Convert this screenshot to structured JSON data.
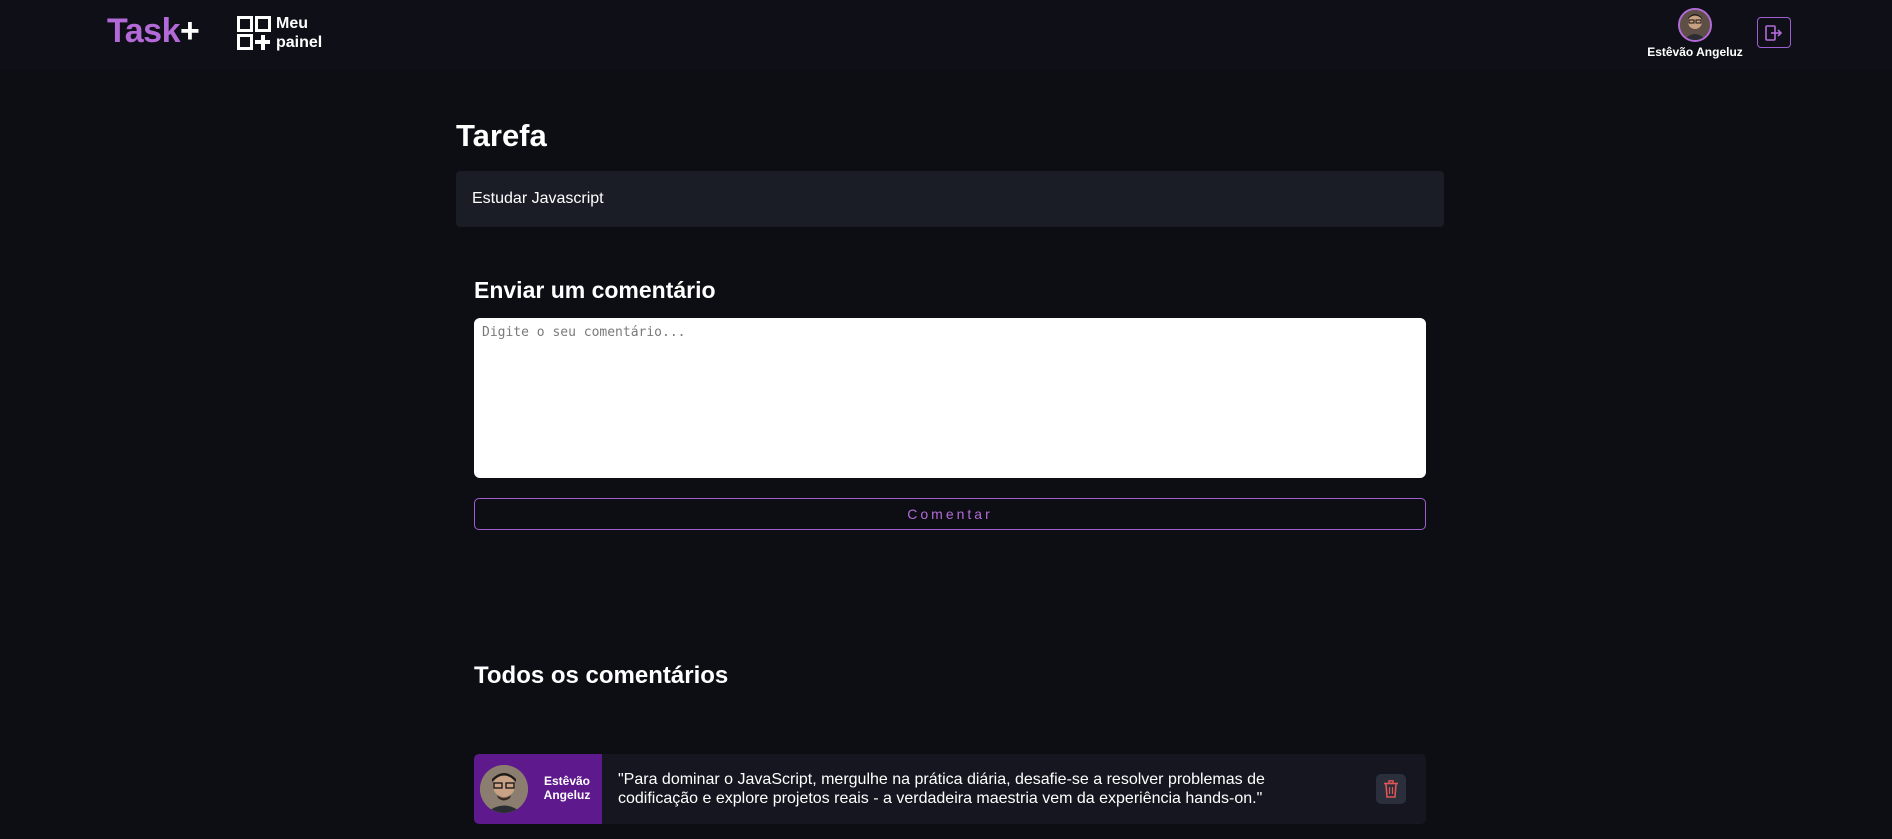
{
  "header": {
    "logo_text": "Task",
    "logo_plus": "+",
    "panel_label": "Meu painel",
    "user_name": "Estêvão Angeluz",
    "icons": {
      "panel": "dashboard-add-icon",
      "logout": "logout-icon"
    }
  },
  "task": {
    "heading": "Tarefa",
    "name": "Estudar Javascript"
  },
  "comment_form": {
    "heading": "Enviar um comentário",
    "placeholder": "Digite o seu comentário...",
    "value": "",
    "button_label": "Comentar"
  },
  "comments": {
    "heading": "Todos os comentários",
    "items": [
      {
        "author_first": "Estêvão",
        "author_last": "Angeluz",
        "text": "\"Para dominar o JavaScript, mergulhe na prática diária, desafie-se a resolver problemas de codificação e explore projetos reais - a verdadeira maestria vem da experiência hands-on.\"",
        "delete_icon": "trash-icon"
      }
    ]
  },
  "colors": {
    "background": "#0d0e14",
    "accent": "#b36ad8",
    "author_badge": "#5e1a8c",
    "task_box": "#1a1c26",
    "delete_icon": "#e05555"
  }
}
